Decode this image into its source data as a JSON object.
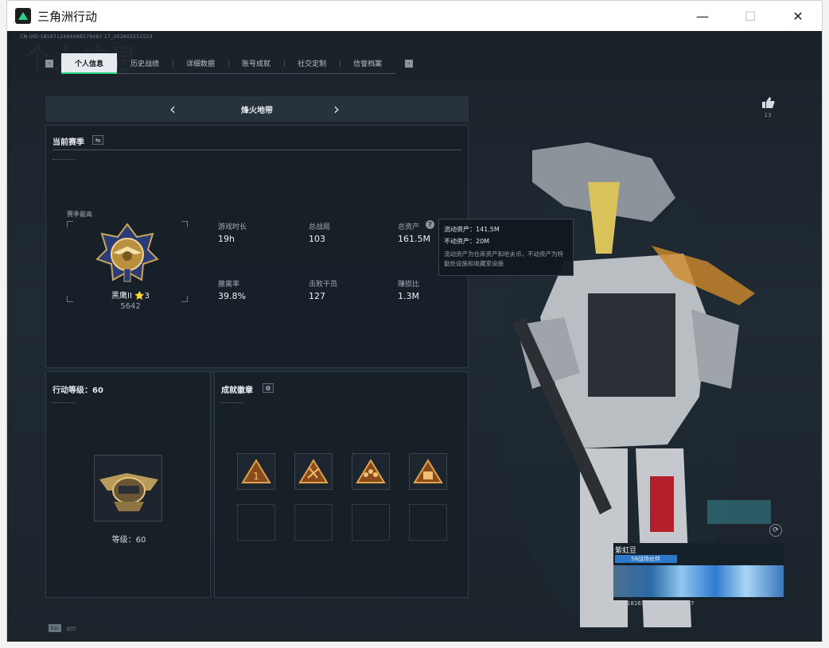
{
  "window": {
    "title": "三角洲行动",
    "controls": {
      "minimize": "—",
      "maximize": "☐",
      "close": "✕"
    }
  },
  "header": {
    "uid_text": "CN·UID:1816712494086579087 17_202605251523",
    "watermark": "个人信息"
  },
  "tabs": [
    {
      "label": "个人信息",
      "active": true
    },
    {
      "label": "历史战绩",
      "active": false
    },
    {
      "label": "详细数据",
      "active": false
    },
    {
      "label": "账号成就",
      "active": false
    },
    {
      "label": "社交定制",
      "active": false
    },
    {
      "label": "信誉档案",
      "active": false
    }
  ],
  "tab_nav": {
    "prev": "‹",
    "next": "›"
  },
  "mode": {
    "title": "烽火地带",
    "prev": "‹",
    "next": "›"
  },
  "season": {
    "title": "当前赛季",
    "switch_icon": "⇋",
    "best_label": "赛季最高",
    "rank_name": "黑鹰II ⭐3",
    "rank_score": "5642",
    "stats": [
      {
        "label": "游戏时长",
        "value": "19h"
      },
      {
        "label": "总战局",
        "value": "103"
      },
      {
        "label": "总资产",
        "value": "161.5M"
      },
      {
        "label": "撤离率",
        "value": "39.8%"
      },
      {
        "label": "击败干员",
        "value": "127"
      },
      {
        "label": "赚损比",
        "value": "1.3M"
      }
    ],
    "help_icon": "?"
  },
  "tooltip": {
    "liquid": "流动资产：141.5M",
    "fixed": "不动资产：20M",
    "desc": "流动资产为仓库资产和哈夫币，不动资产为特勤处设施和收藏室设施"
  },
  "level_panel": {
    "title": "行动等级：60",
    "level_label": "等级：60"
  },
  "badges_panel": {
    "title": "成就徽章",
    "settings_icon": "⚙",
    "badges": [
      "rank-1-badge",
      "tools-badge",
      "squad-badge",
      "loot-badge"
    ],
    "empty_slots": 4
  },
  "like": {
    "icon": "👍",
    "count": "13"
  },
  "player_card": {
    "name": "紫虹豆",
    "tag": "58战场伙伴",
    "id_text": "UID:1816712494086579087"
  },
  "esc": {
    "key": "Esc",
    "label": "返回"
  },
  "colors": {
    "accent": "#2ed08a",
    "panel": "#161e26",
    "tag_blue": "#2b79c8"
  }
}
